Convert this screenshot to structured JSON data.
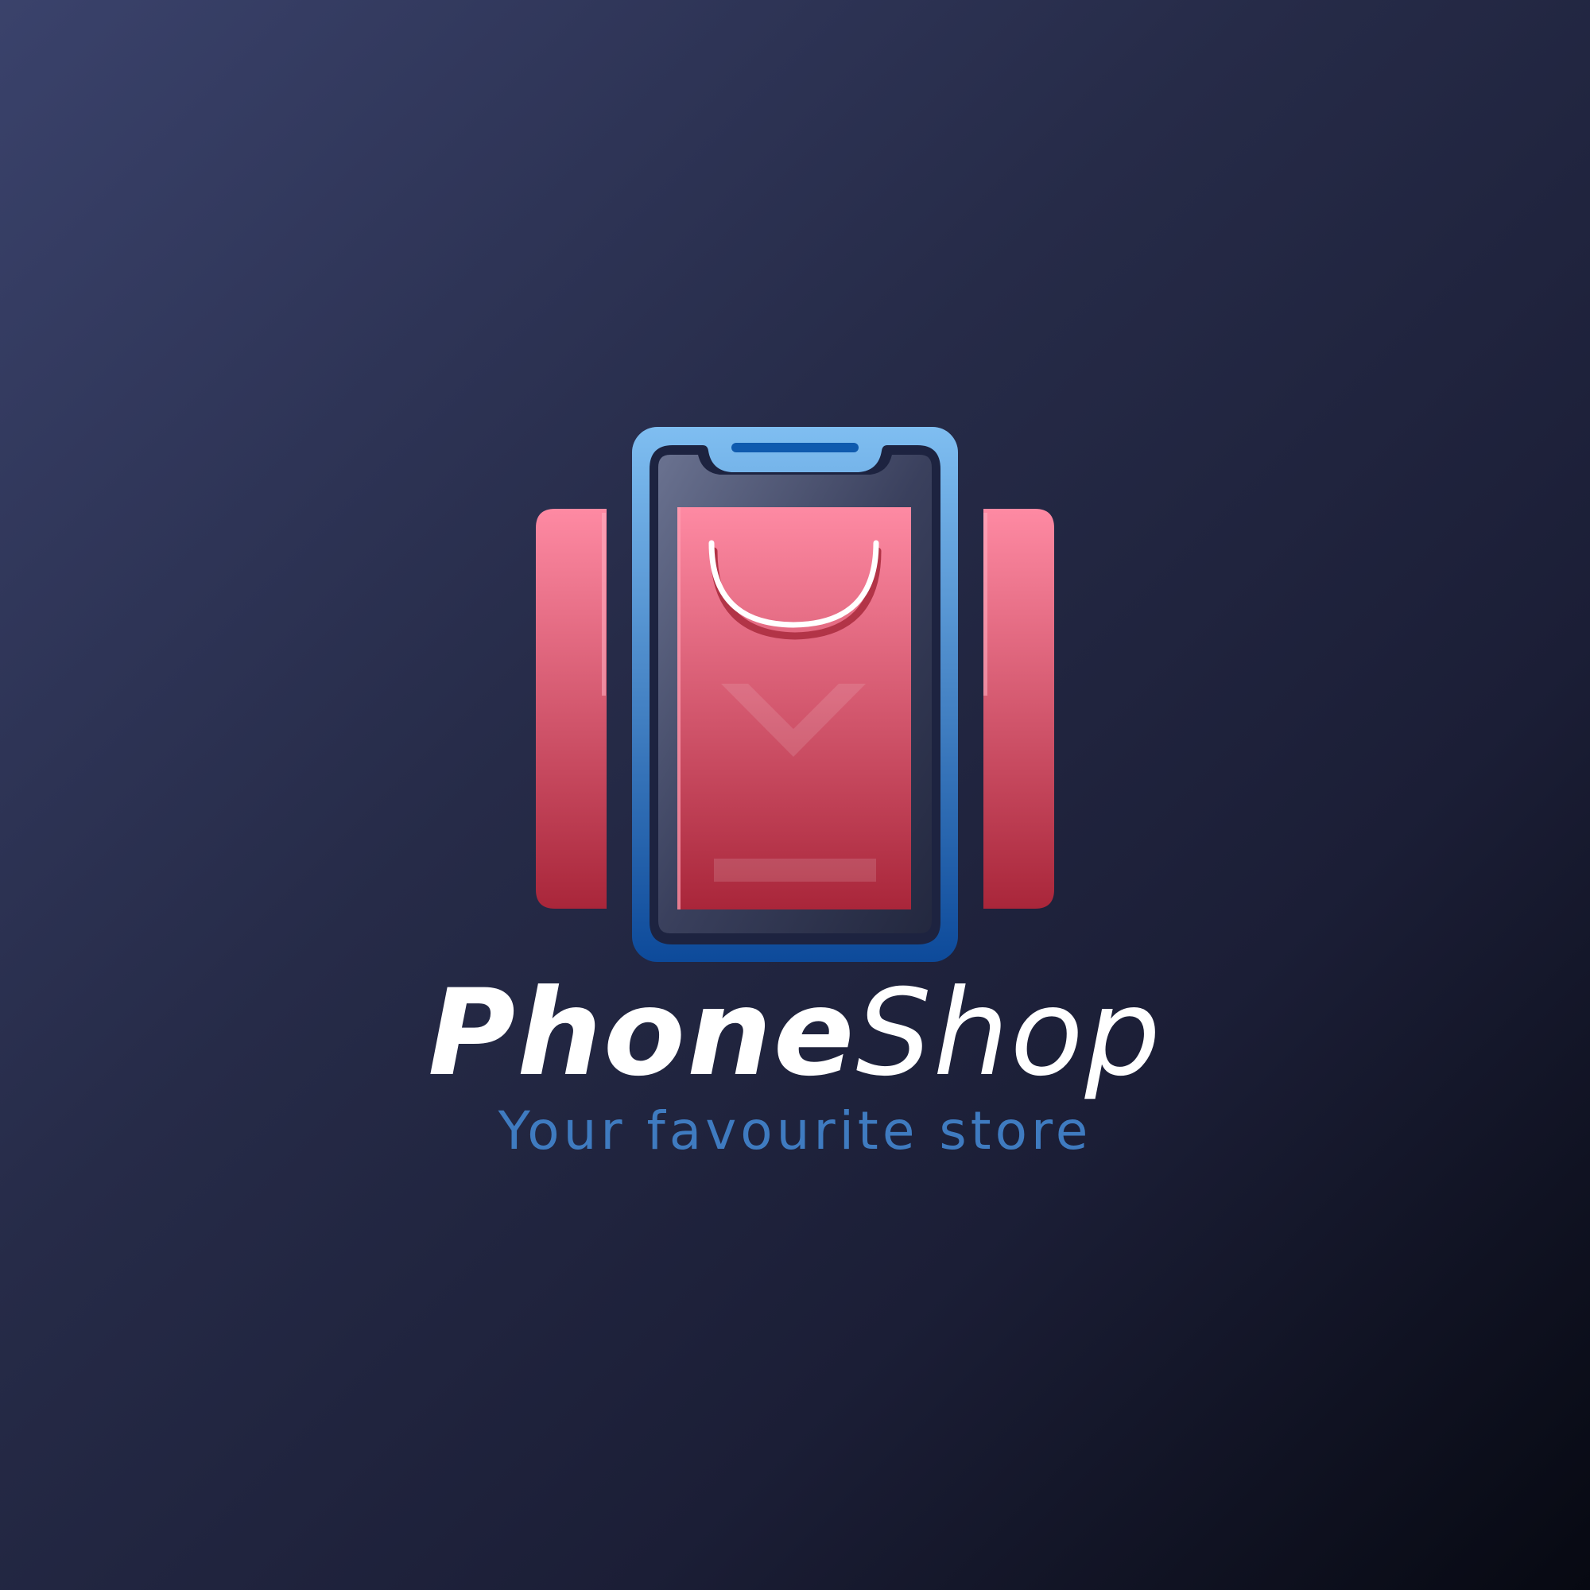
{
  "brand": {
    "name_bold": "Phone",
    "name_light": "Shop",
    "tagline": "Your favourite store"
  },
  "colors": {
    "background_start": "#3a426b",
    "background_end": "#070912",
    "phone_frame_top": "#7fbef1",
    "phone_frame_bottom": "#0d4a9a",
    "bag_pink": "#fe8aa3",
    "bag_red": "#a9263a",
    "tagline": "#3f7bc0",
    "wordmark": "#ffffff"
  },
  "icons": {
    "logo": "phone-with-shopping-bag-icon"
  }
}
